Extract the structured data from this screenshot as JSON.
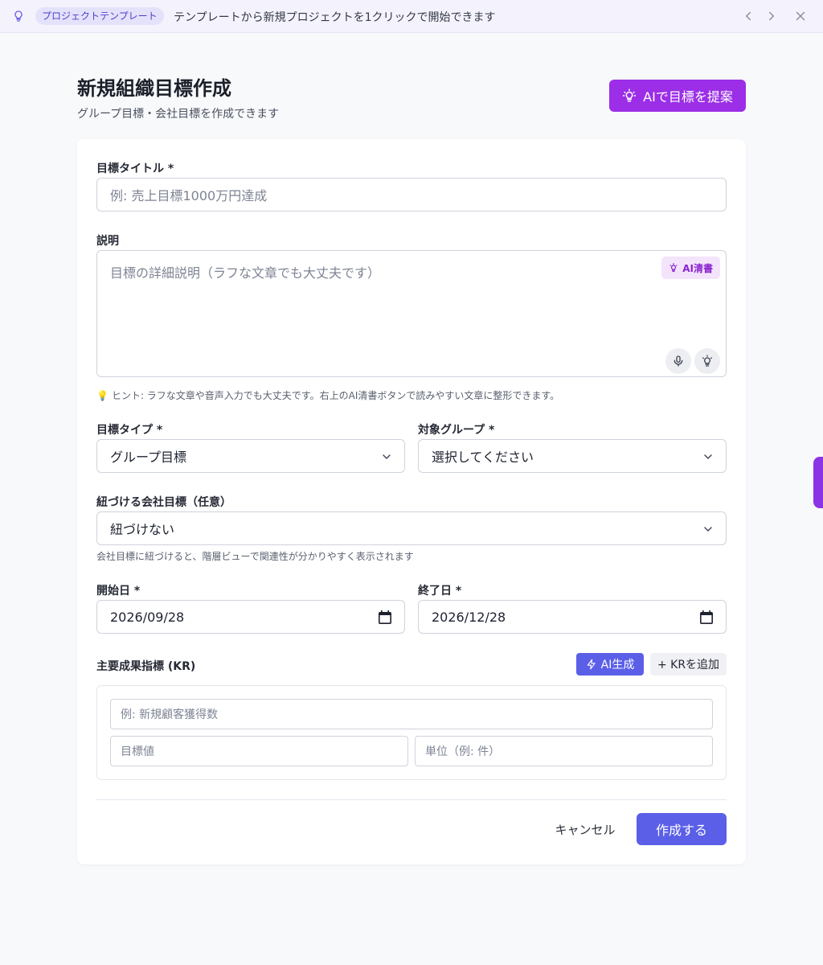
{
  "banner": {
    "tag": "プロジェクトテンプレート",
    "message": "テンプレートから新規プロジェクトを1クリックで開始できます"
  },
  "header": {
    "title": "新規組織目標作成",
    "subtitle": "グループ目標・会社目標を作成できます",
    "ai_suggest_label": "AIで目標を提案"
  },
  "form": {
    "title_label": "目標タイトル *",
    "title_placeholder": "例: 売上目標1000万円達成",
    "description_label": "説明",
    "description_placeholder": "目標の詳細説明（ラフな文章でも大丈夫です）",
    "ai_clean_label": "AI清書",
    "hint_emoji": "💡",
    "hint": "ヒント: ラフな文章や音声入力でも大丈夫です。右上のAI清書ボタンで読みやすい文章に整形できます。",
    "type_label": "目標タイプ *",
    "type_value": "グループ目標",
    "group_label": "対象グループ *",
    "group_value": "選択してください",
    "parent_label": "紐づける会社目標（任意）",
    "parent_value": "紐づけない",
    "parent_hint": "会社目標に紐づけると、階層ビューで関連性が分かりやすく表示されます",
    "start_label": "開始日 *",
    "start_value": "2026/09/28",
    "end_label": "終了日 *",
    "end_value": "2026/12/28",
    "kr_label": "主要成果指標 (KR)",
    "kr_ai_label": "AI生成",
    "kr_add_label": "+ KRを追加",
    "kr_name_placeholder": "例: 新規顧客獲得数",
    "kr_target_placeholder": "目標値",
    "kr_unit_placeholder": "単位（例: 件）",
    "cancel_label": "キャンセル",
    "submit_label": "作成する"
  },
  "icons": {
    "banner": "lightbulb-icon",
    "nav": [
      "chevron-left-icon",
      "chevron-right-icon",
      "close-icon"
    ],
    "select": "chevron-down-icon",
    "date": "calendar-icon",
    "mic": "microphone-icon",
    "ai": "lightbulb-icon",
    "kr_ai": "lightning-icon"
  },
  "colors": {
    "primary": "#5b5fe8",
    "ai_purple": "#9b2ee6",
    "ai_clean_bg": "#f3e4fb",
    "banner_bg": "#f4f3fd"
  }
}
